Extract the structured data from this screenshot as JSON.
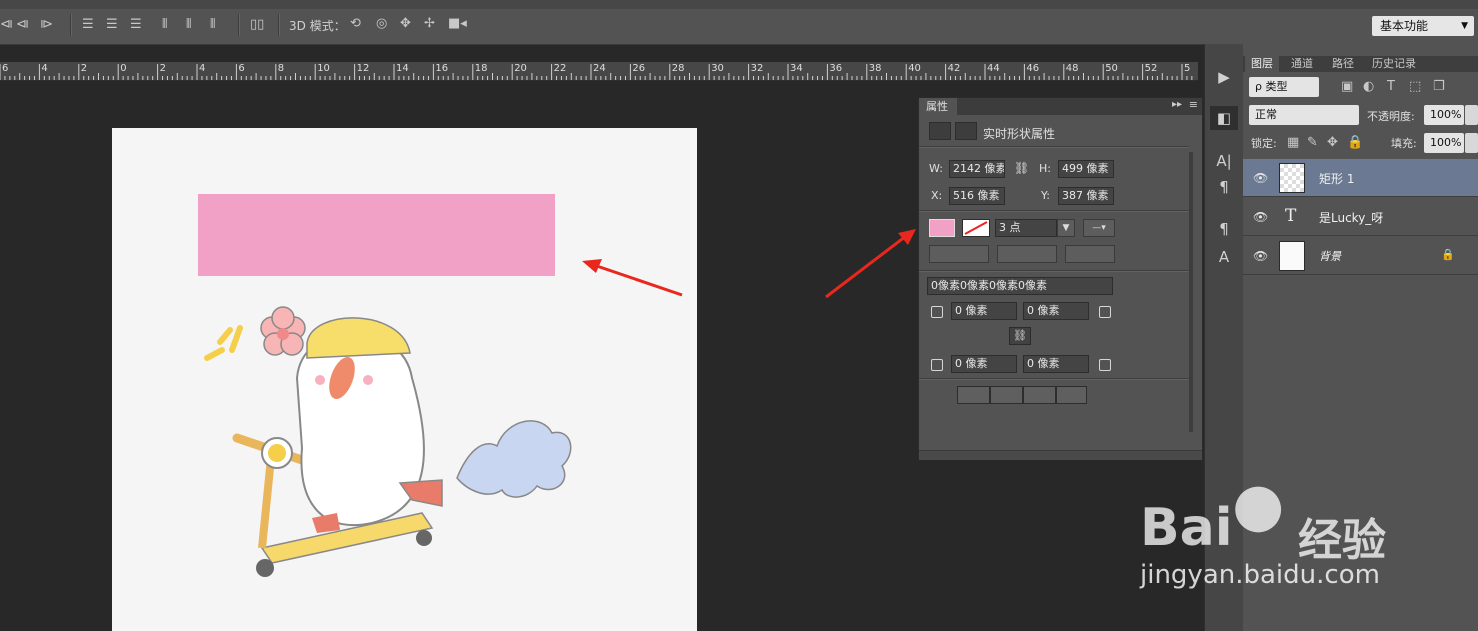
{
  "options_bar": {
    "mode_3d_label": "3D 模式：",
    "workspace_label": "基本功能"
  },
  "ruler": {
    "labels": [
      "6",
      "4",
      "2",
      "0",
      "2",
      "4",
      "6",
      "8",
      "10",
      "12",
      "14",
      "16",
      "18",
      "20",
      "22",
      "24",
      "26",
      "28",
      "30",
      "32",
      "34",
      "36",
      "38",
      "40",
      "42",
      "44",
      "46",
      "48",
      "50",
      "52",
      "5"
    ]
  },
  "properties": {
    "tab_label": "属性",
    "title": "实时形状属性",
    "w_label": "W:",
    "w_value": "2142 像素",
    "h_label": "H:",
    "h_value": "499 像素",
    "x_label": "X:",
    "x_value": "516 像素",
    "y_label": "Y:",
    "y_value": "387 像素",
    "fill_color": "#f1a1c5",
    "stroke_width": "3 点",
    "corner_summary": "0像素0像素0像素0像素",
    "corner_tl": "0 像素",
    "corner_tr": "0 像素",
    "corner_bl": "0 像素",
    "corner_br": "0 像素"
  },
  "canvas": {
    "rect_color": "#f1a1c5",
    "background": "#f5f5f5"
  },
  "layers_panel": {
    "tabs": [
      "图层",
      "通道",
      "路径",
      "历史记录"
    ],
    "filter_label": "ρ 类型",
    "blend_mode": "正常",
    "opacity_label": "不透明度:",
    "opacity_value": "100%",
    "lock_label": "锁定:",
    "fill_label": "填充:",
    "fill_value": "100%",
    "layers": [
      {
        "name": "矩形 1",
        "selected": true
      },
      {
        "name": "是Lucky_呀",
        "selected": false
      },
      {
        "name": "背景",
        "selected": false
      }
    ]
  },
  "watermark": {
    "brand": "Bai",
    "brand_cn": "经验",
    "url": "jingyan.baidu.com"
  }
}
